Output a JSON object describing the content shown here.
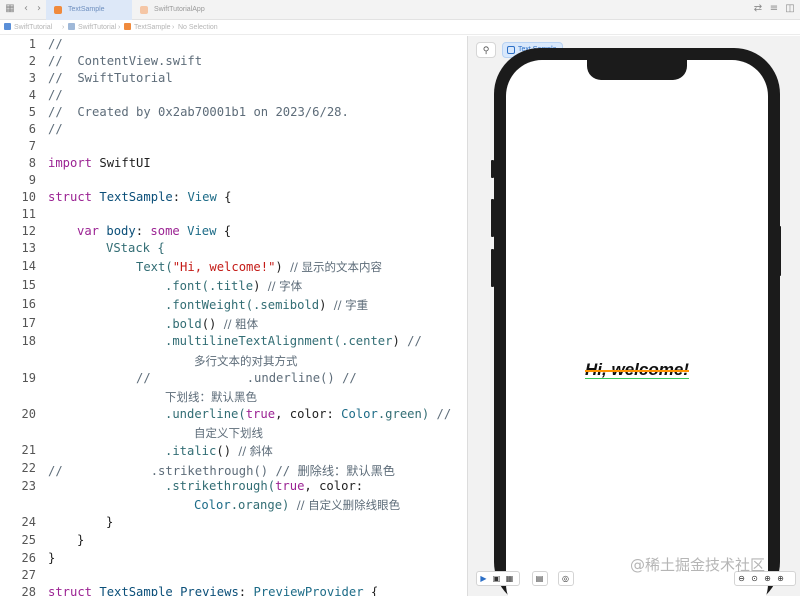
{
  "tabs": [
    {
      "label": "TextSample",
      "active": true
    },
    {
      "label": "SwiftTutorialApp",
      "active": false
    }
  ],
  "breadcrumb": [
    "SwiftTutorial",
    "SwiftTutorial",
    "TextSample",
    "No Selection"
  ],
  "editor": {
    "line_numbers": [
      "1",
      "2",
      "3",
      "4",
      "5",
      "6",
      "7",
      "8",
      "9",
      "10",
      "11",
      "12",
      "13",
      "14",
      "15",
      "16",
      "17",
      "18",
      "",
      "19",
      "",
      "20",
      "",
      "21",
      "22",
      "23",
      "",
      "24",
      "25",
      "26",
      "27",
      "28"
    ]
  },
  "code": {
    "l1": "//",
    "l2": "//  ContentView.swift",
    "l3": "//  SwiftTutorial",
    "l4": "//",
    "l5": "//  Created by 0x2ab70001b1 on 2023/6/28.",
    "l6": "//",
    "l8_kw": "import",
    "l8_rest": " SwiftUI",
    "l10_kw": "struct",
    "l10_name": "TextSample",
    "l10_colon": ": ",
    "l10_type": "View",
    "l10_end": " {",
    "l12_kw": "var",
    "l12_name": "body",
    "l12_colon": ": ",
    "l12_some": "some",
    "l12_type": " View",
    "l12_end": " {",
    "l13": "VStack {",
    "l14_a": "Text(",
    "l14_str": "\"Hi, welcome!\"",
    "l14_b": ") ",
    "l14_cmt": "// 显示的文本内容",
    "l15_a": ".font(.",
    "l15_b": "title",
    "l15_c": ") ",
    "l15_cmt": "// 字体",
    "l16_a": ".fontWeight(.",
    "l16_b": "semibold",
    "l16_c": ") ",
    "l16_cmt": "// 字重",
    "l17_a": ".bold",
    "l17_b": "() ",
    "l17_cmt": "// 粗体",
    "l18_a": ".multilineTextAlignment(.",
    "l18_b": "center",
    "l18_c": ") ",
    "l18_cmt": "//",
    "l18_wrap": "多行文本的对其方式",
    "l19_a": "//",
    "l19_b": ".underline() //",
    "l19_wrap": "下划线：默认黑色",
    "l20_a": ".underline(",
    "l20_true": "true",
    "l20_b": ", color: ",
    "l20_color": "Color",
    "l20_c": ".green) ",
    "l20_cmt": "//",
    "l20_wrap": "自定义下划线",
    "l21_a": ".italic",
    "l21_b": "() ",
    "l21_cmt": "// 斜体",
    "l22": "//            .strikethrough() // 删除线：默认黑色",
    "l23_a": ".strikethrough(",
    "l23_true": "true",
    "l23_b": ", color:",
    "l23w_color": "Color",
    "l23w_b": ".orange) ",
    "l23w_cmt": "// 自定义删除线眼色",
    "l24": "}",
    "l25": "}",
    "l26": "}",
    "l28_kw": "struct",
    "l28_name": "TextSample_Previews",
    "l28_colon": ": ",
    "l28_type": "PreviewProvider",
    "l28_end": " {"
  },
  "preview": {
    "tab_label": "Text Sample",
    "text": "Hi, welcome!",
    "underline_color": "#34c759",
    "strike_color": "#ff9500"
  },
  "watermark": "@稀土掘金技术社区",
  "colors": {
    "keyword": "#9b2393",
    "type": "#0b4f79",
    "string": "#c41a16",
    "comment": "#5d6c79",
    "accent": "#2c6fc6"
  }
}
